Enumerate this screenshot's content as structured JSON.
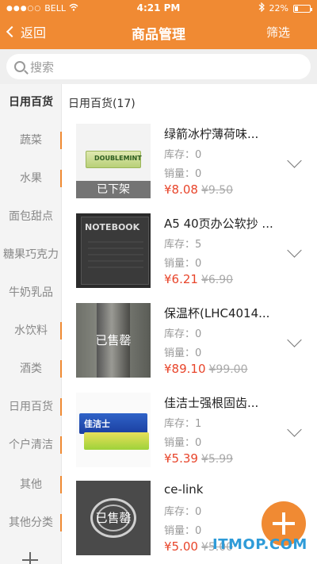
{
  "status_bar": {
    "carrier": "BELL",
    "time": "4:21 PM",
    "battery": "22%",
    "battery_level": 0.22
  },
  "nav": {
    "back_label": "返回",
    "title": "商品管理",
    "filter_label": "筛选"
  },
  "search": {
    "placeholder": "搜索"
  },
  "sidebar": {
    "items": [
      {
        "label": "日用百货",
        "active": true
      },
      {
        "label": "蔬菜"
      },
      {
        "label": "水果"
      },
      {
        "label": "面包甜点"
      },
      {
        "label": "糖果巧克力"
      },
      {
        "label": "牛奶乳品"
      },
      {
        "label": "水饮料"
      },
      {
        "label": "酒类"
      },
      {
        "label": "日用百货"
      },
      {
        "label": "个户清洁"
      },
      {
        "label": "其他"
      },
      {
        "label": "其他分类"
      }
    ]
  },
  "main": {
    "section_title": "日用百货(17)",
    "products": [
      {
        "name": "绿箭冰柠薄荷味...",
        "stock": "库存：0",
        "sales": "销量：0",
        "price": "¥8.08",
        "orig_price": "¥9.50",
        "badge": "已下架",
        "image_text": "DOUBLEMINT"
      },
      {
        "name": "A5 40页办公软抄 ...",
        "stock": "库存：5",
        "sales": "销量：0",
        "price": "¥6.21",
        "orig_price": "¥6.90",
        "badge": "",
        "image_text": "NOTEBOOK"
      },
      {
        "name": "保温杯(LHC4014...",
        "stock": "库存：0",
        "sales": "销量：0",
        "price": "¥89.10",
        "orig_price": "¥99.00",
        "badge": "已售罄",
        "image_text": ""
      },
      {
        "name": "佳洁士强根固齿...",
        "stock": "库存：1",
        "sales": "销量：0",
        "price": "¥5.39",
        "orig_price": "¥5.99",
        "badge": "",
        "image_text": "佳洁士"
      },
      {
        "name": "ce-link",
        "stock": "库存：0",
        "sales": "销量：0",
        "price": "¥5.00",
        "orig_price": "¥5.00",
        "badge": "已售罄",
        "image_text": ""
      }
    ]
  },
  "watermark": "ITMOP.COM",
  "colors": {
    "accent": "#f08a33",
    "price": "#e8452b"
  }
}
